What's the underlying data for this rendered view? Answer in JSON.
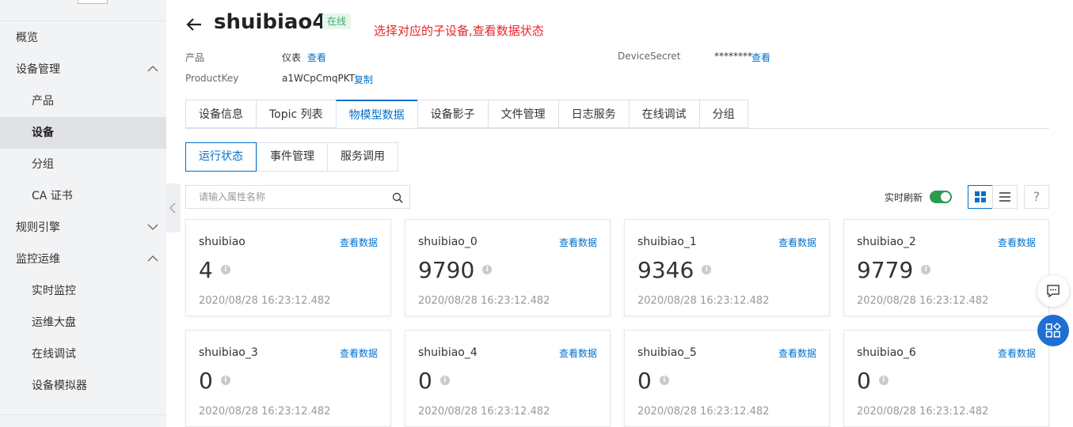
{
  "sidebar": {
    "items": [
      {
        "label": "概览"
      },
      {
        "label": "设备管理"
      },
      {
        "label": "产品"
      },
      {
        "label": "设备"
      },
      {
        "label": "分组"
      },
      {
        "label": "CA 证书"
      },
      {
        "label": "规则引擎"
      },
      {
        "label": "监控运维"
      },
      {
        "label": "实时监控"
      },
      {
        "label": "运维大盘"
      },
      {
        "label": "在线调试"
      },
      {
        "label": "设备模拟器"
      }
    ]
  },
  "header": {
    "device_name": "shuibiao4",
    "status": "在线",
    "annotation": "选择对应的子设备,查看数据状态"
  },
  "meta": {
    "product_label": "产品",
    "product_value": "仪表",
    "product_link": "查看",
    "productkey_label": "ProductKey",
    "productkey_value": "a1WCpCmqPKT",
    "productkey_link": "复制",
    "secret_label": "DeviceSecret",
    "secret_value": "********",
    "secret_link": "查看"
  },
  "tabs": [
    "设备信息",
    "Topic 列表",
    "物模型数据",
    "设备影子",
    "文件管理",
    "日志服务",
    "在线调试",
    "分组"
  ],
  "subtabs": [
    "运行状态",
    "事件管理",
    "服务调用"
  ],
  "search": {
    "placeholder": "请输入属性名称"
  },
  "controls": {
    "refresh_label": "实时刷新",
    "help": "?"
  },
  "cards": [
    {
      "name": "shuibiao",
      "link": "查看数据",
      "value": "4",
      "time": "2020/08/28 16:23:12.482"
    },
    {
      "name": "shuibiao_0",
      "link": "查看数据",
      "value": "9790",
      "time": "2020/08/28 16:23:12.482"
    },
    {
      "name": "shuibiao_1",
      "link": "查看数据",
      "value": "9346",
      "time": "2020/08/28 16:23:12.482"
    },
    {
      "name": "shuibiao_2",
      "link": "查看数据",
      "value": "9779",
      "time": "2020/08/28 16:23:12.482"
    },
    {
      "name": "shuibiao_3",
      "link": "查看数据",
      "value": "0",
      "time": "2020/08/28 16:23:12.482"
    },
    {
      "name": "shuibiao_4",
      "link": "查看数据",
      "value": "0",
      "time": "2020/08/28 16:23:12.482"
    },
    {
      "name": "shuibiao_5",
      "link": "查看数据",
      "value": "0",
      "time": "2020/08/28 16:23:12.482"
    },
    {
      "name": "shuibiao_6",
      "link": "查看数据",
      "value": "0",
      "time": "2020/08/28 16:23:12.482"
    }
  ],
  "colors": {
    "accent": "#0070cc",
    "online": "#3cab6b",
    "annotation": "#e5252a",
    "toggle_on": "#2e9a4e"
  }
}
